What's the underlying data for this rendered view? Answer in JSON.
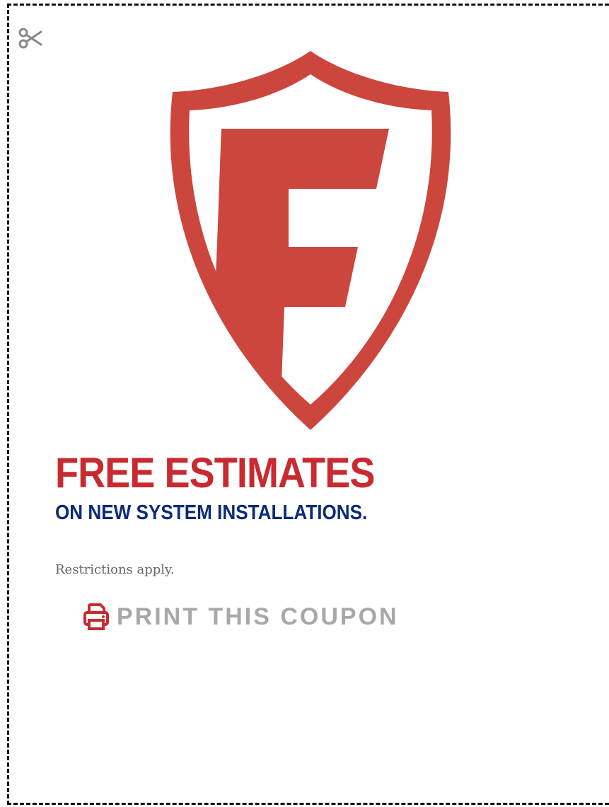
{
  "brand_logo": {
    "letter": "F",
    "color": "#cc463d"
  },
  "scissors_icon": {
    "name": "scissors-icon",
    "color": "#888888"
  },
  "coupon": {
    "headline": "FREE ESTIMATES",
    "headline_color": "#c92a30",
    "subheadline": "ON NEW SYSTEM INSTALLATIONS.",
    "subheadline_color": "#0b2a78",
    "restrictions": "Restrictions apply.",
    "print_button": {
      "icon": "printer-icon",
      "icon_color": "#c92a30",
      "label": "PRINT THIS COUPON",
      "label_color": "#a8a8a8"
    }
  }
}
